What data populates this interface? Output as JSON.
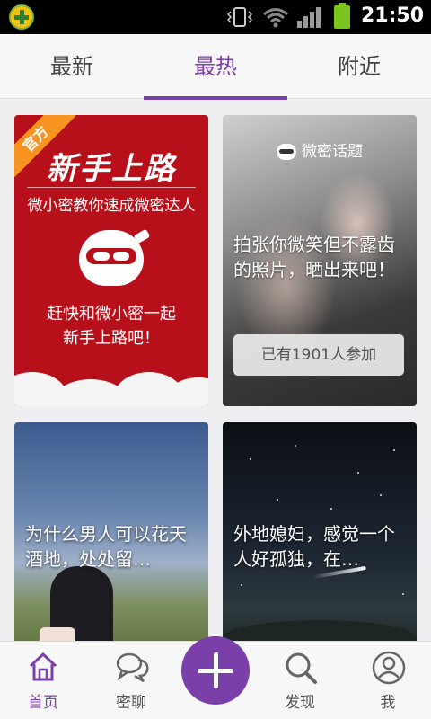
{
  "status_bar": {
    "time": "21:50",
    "icons": [
      "app-icon",
      "vibrate-icon",
      "wifi-icon",
      "signal-icon",
      "battery-icon"
    ]
  },
  "tabs": [
    {
      "label": "最新",
      "active": false
    },
    {
      "label": "最热",
      "active": true
    },
    {
      "label": "附近",
      "active": false
    }
  ],
  "cards": {
    "official": {
      "badge": "官方",
      "title": "新手上路",
      "subtitle": "微小密教你速成微密达人",
      "text_line1": "赶快和微小密一起",
      "text_line2": "新手上路吧！"
    },
    "topic": {
      "header": "微密话题",
      "text": "拍张你微笑但不露齿的照片，晒出来吧！",
      "button": "已有1901人参加"
    },
    "post1": {
      "text": "为什么男人可以花天酒地，处处留…"
    },
    "post2": {
      "text": "外地媳妇，感觉一个人好孤独，在…"
    }
  },
  "bottom_nav": {
    "home": "首页",
    "chat": "密聊",
    "discover": "发现",
    "me": "我"
  },
  "accent_color": "#7a3fa8"
}
